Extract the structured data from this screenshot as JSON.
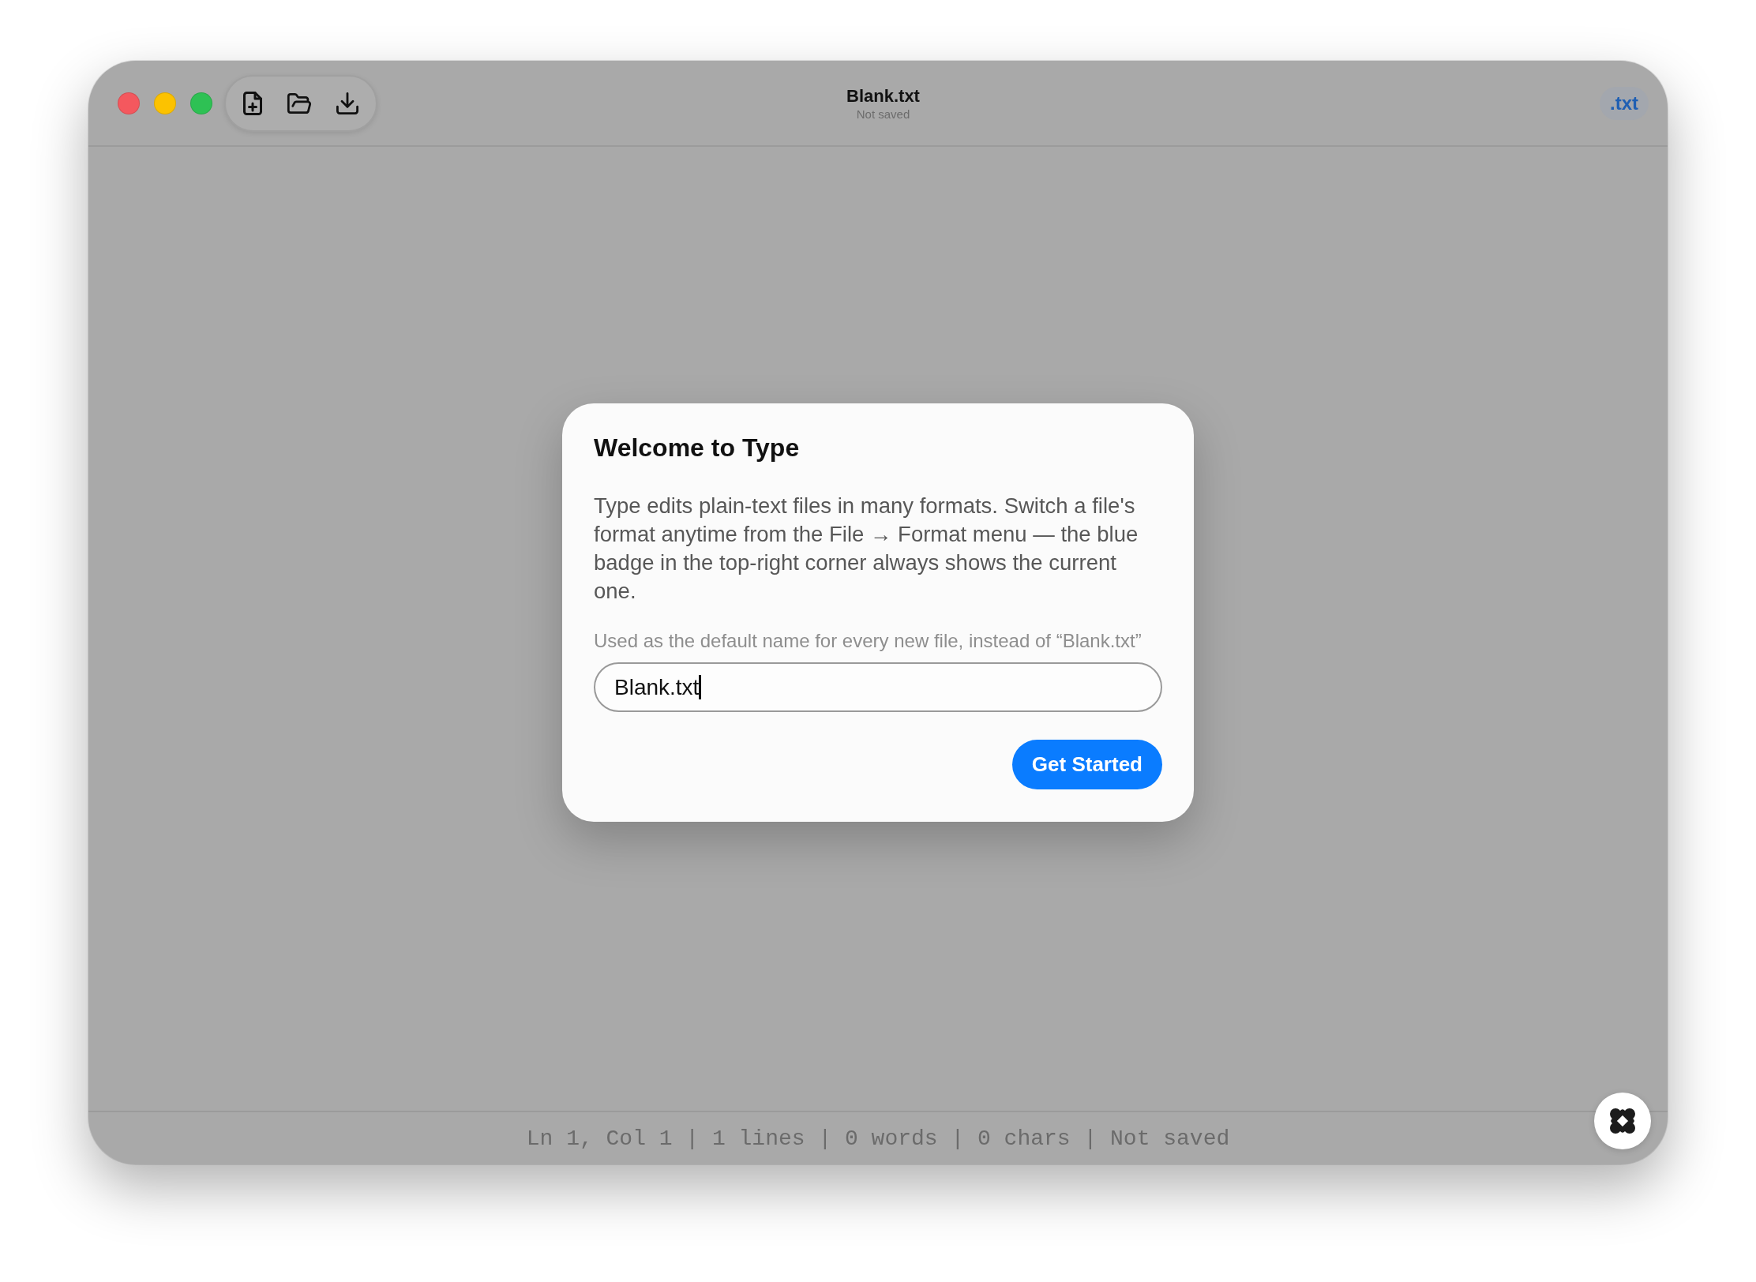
{
  "window": {
    "title": "Blank.txt",
    "subtitle": "Not saved",
    "format_badge": ".txt"
  },
  "dialog": {
    "title": "Welcome to Type",
    "body": "Type edits plain-text files in many formats. Switch a file's format anytime from the File → Format menu — the blue badge in the top-right corner always shows the current one.",
    "field": {
      "label": "Used as the default name for every new file, instead of “Blank.txt”",
      "value": "Blank.txt",
      "focused": true
    },
    "button": "Get Started"
  },
  "status_bar": {
    "text": "Ln 1, Col 1 | 1 lines | 0 words | 0 chars | Not saved"
  }
}
